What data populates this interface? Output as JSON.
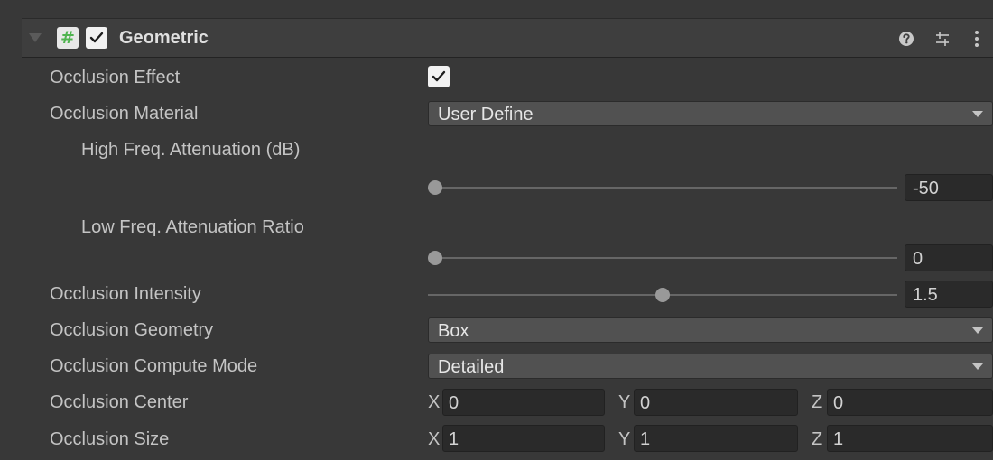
{
  "component": {
    "title": "Geometric",
    "enabled": true,
    "icons": {
      "fold": "fold-arrow-icon",
      "script": "script-hash-icon",
      "help": "help-icon",
      "preset": "preset-sliders-icon",
      "menu": "kebab-menu-icon"
    }
  },
  "properties": {
    "occlusion_effect": {
      "label": "Occlusion Effect",
      "checked": true
    },
    "occlusion_material": {
      "label": "Occlusion Material",
      "value": "User Define"
    },
    "high_freq": {
      "label": "High Freq. Attenuation (dB)",
      "value": "-50",
      "fraction": 0.0
    },
    "low_freq": {
      "label": "Low Freq. Attenuation Ratio",
      "value": "0",
      "fraction": 0.0
    },
    "intensity": {
      "label": "Occlusion Intensity",
      "value": "1.5",
      "fraction": 0.5
    },
    "geometry": {
      "label": "Occlusion Geometry",
      "value": "Box"
    },
    "compute_mode": {
      "label": "Occlusion Compute Mode",
      "value": "Detailed"
    },
    "center": {
      "label": "Occlusion Center",
      "x_label": "X",
      "x": "0",
      "y_label": "Y",
      "y": "0",
      "z_label": "Z",
      "z": "0"
    },
    "size": {
      "label": "Occlusion Size",
      "x_label": "X",
      "x": "1",
      "y_label": "Y",
      "y": "1",
      "z_label": "Z",
      "z": "1"
    }
  },
  "colors": {
    "background": "#383838",
    "script_icon_green": "#4fb44f"
  }
}
